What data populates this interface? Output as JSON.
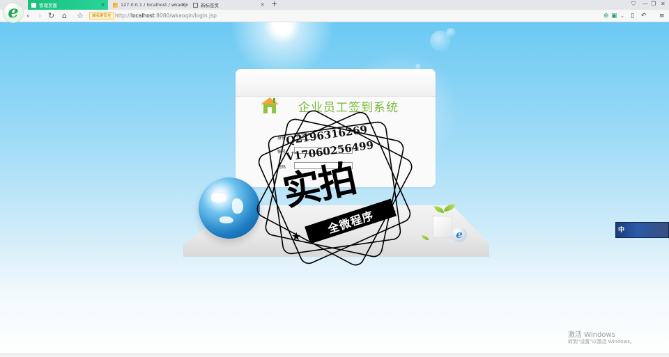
{
  "browser": {
    "tabs": [
      {
        "label": "管理页面",
        "active": true
      },
      {
        "label": "127.0.0.1 / localhost / wkaoqin",
        "active": false
      },
      {
        "label": "新标签页",
        "active": false
      }
    ],
    "new_tab": "+",
    "security_badge": "城名更安全",
    "url_prefix": "http://",
    "url_host": "localhost",
    "url_path": ":8080/wkaoqin/login.jsp",
    "accent": "#18c27b"
  },
  "page": {
    "system_title": "企业员工签到系统",
    "form": {
      "identity_label": "身份",
      "identity_value": "员工",
      "account_label": "帐号",
      "password_label": "密码"
    },
    "watermark": {
      "qq": "Q2196316269",
      "vx": "V17060256499",
      "main": "实拍",
      "ribbon": "全微程序"
    },
    "ime_indicator": "中"
  },
  "os": {
    "activate_title": "激活 Windows",
    "activate_sub": "转到\"设置\"以激活 Windows。"
  }
}
